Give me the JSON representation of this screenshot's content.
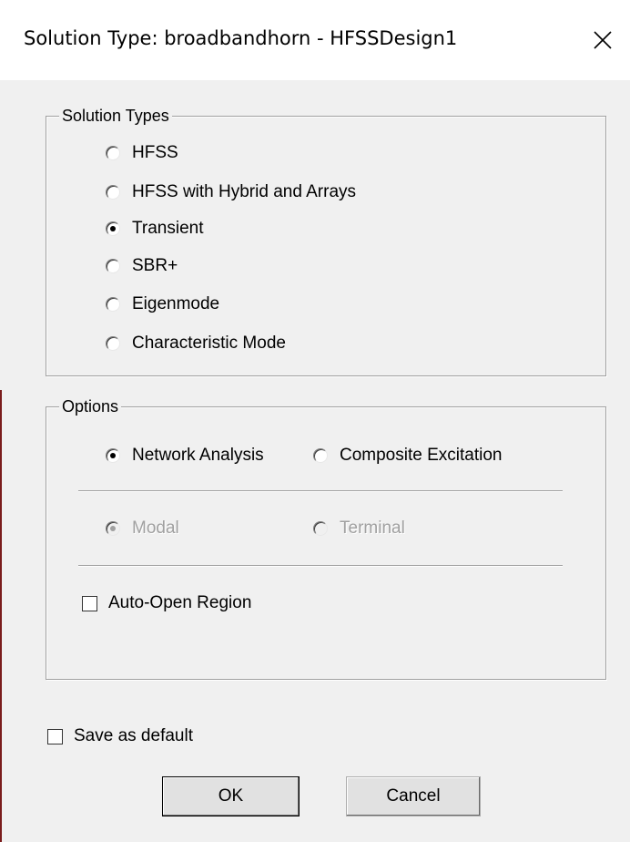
{
  "window": {
    "title": "Solution Type: broadbandhorn - HFSSDesign1",
    "close_icon": "close-icon"
  },
  "solution_types": {
    "legend": "Solution Types",
    "options": [
      {
        "label": "HFSS",
        "checked": false
      },
      {
        "label": "HFSS with Hybrid and Arrays",
        "checked": false
      },
      {
        "label": "Transient",
        "checked": true
      },
      {
        "label": "SBR+",
        "checked": false
      },
      {
        "label": "Eigenmode",
        "checked": false
      },
      {
        "label": "Characteristic Mode",
        "checked": false
      }
    ]
  },
  "options": {
    "legend": "Options",
    "network_analysis": {
      "label": "Network Analysis",
      "checked": true
    },
    "composite_excitation": {
      "label": "Composite Excitation",
      "checked": false
    },
    "modal": {
      "label": "Modal",
      "checked": true,
      "disabled": true
    },
    "terminal": {
      "label": "Terminal",
      "checked": false,
      "disabled": true
    },
    "auto_open_region": {
      "label": "Auto-Open Region",
      "checked": false
    }
  },
  "save_as_default": {
    "label": "Save as default",
    "checked": false
  },
  "buttons": {
    "ok_label": "OK",
    "cancel_label": "Cancel"
  }
}
